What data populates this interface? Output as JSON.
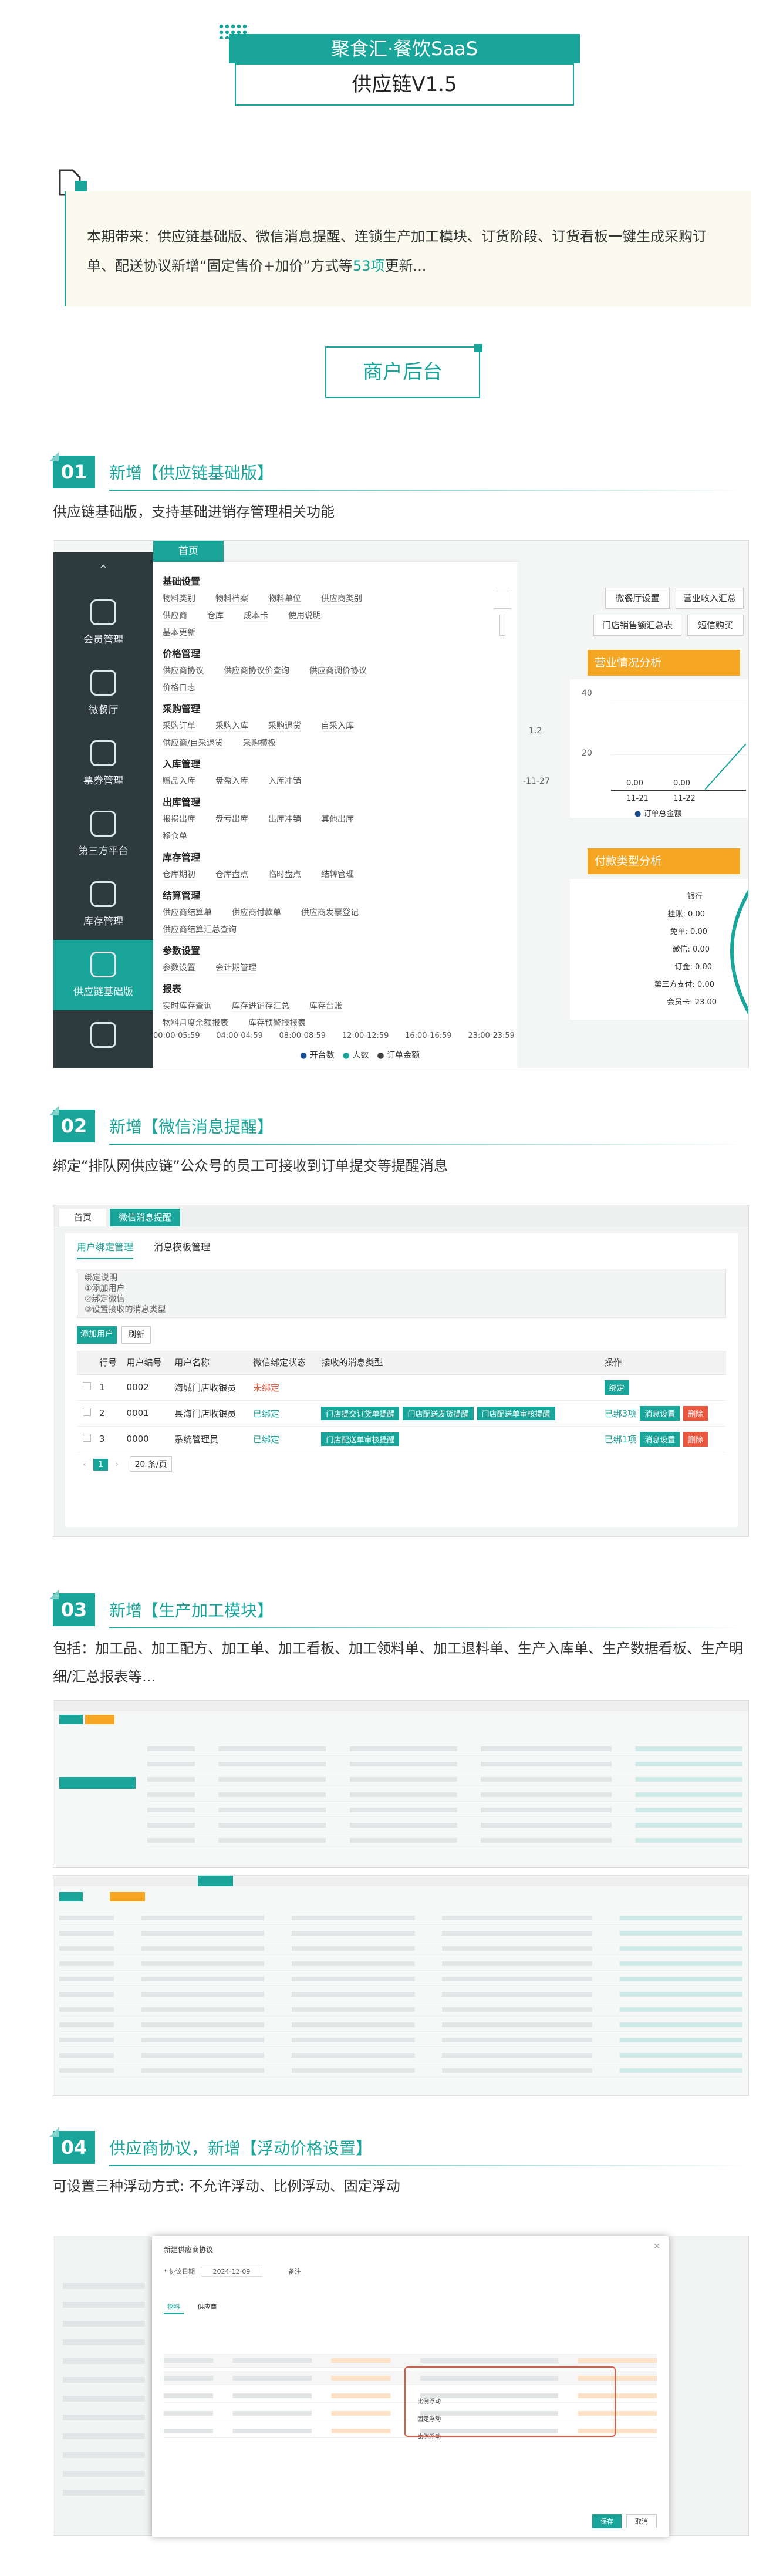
{
  "header": {
    "brand": "聚食汇·餐饮SaaS",
    "version": "供应链V1.5"
  },
  "intro": {
    "text_before": "本期带来：供应链基础版、微信消息提醒、连锁生产加工模块、订货阶段、订货看板一键生成采购订单、配送协议新增“固定售价+加价”方式等",
    "highlight": "53项",
    "text_after": "更新..."
  },
  "merchant_title": "商户后台",
  "sections": [
    {
      "num": "01",
      "title": "新增【供应链基础版】",
      "desc": "供应链基础版，支持基础进销存管理相关功能"
    },
    {
      "num": "02",
      "title": "新增【微信消息提醒】",
      "desc": "绑定“排队网供应链”公众号的员工可接收到订单提交等提醒消息"
    },
    {
      "num": "03",
      "title": "新增【生产加工模块】",
      "desc": "包括：加工品、加工配方、加工单、加工看板、加工领料单、加工退料单、生产入库单、生产数据看板、生产明细/汇总报表等..."
    },
    {
      "num": "04",
      "title": "供应商协议，新增【浮动价格设置】",
      "desc": "可设置三种浮动方式: 不允许浮动、比例浮动、固定浮动"
    }
  ],
  "shot1": {
    "tab": "首页",
    "sidebar": [
      "会员管理",
      "微餐厅",
      "票券管理",
      "第三方平台",
      "库存管理",
      "供应链基础版",
      ""
    ],
    "menu": [
      {
        "group": "基础设置",
        "rows": [
          [
            "物料类别",
            "物料档案",
            "物料单位",
            "供应商类别"
          ],
          [
            "供应商",
            "仓库",
            "成本卡",
            "使用说明"
          ],
          [
            "基本更新"
          ]
        ]
      },
      {
        "group": "价格管理",
        "rows": [
          [
            "供应商协议",
            "供应商协议价查询",
            "供应商调价协议"
          ],
          [
            "价格日志"
          ]
        ]
      },
      {
        "group": "采购管理",
        "rows": [
          [
            "采购订单",
            "采购入库",
            "采购退货",
            "自采入库"
          ],
          [
            "供应商/自采退货",
            "采购横板"
          ]
        ]
      },
      {
        "group": "入库管理",
        "rows": [
          [
            "赠品入库",
            "盘盈入库",
            "入库冲销"
          ]
        ]
      },
      {
        "group": "出库管理",
        "rows": [
          [
            "报损出库",
            "盘亏出库",
            "出库冲销",
            "其他出库"
          ],
          [
            "移仓单"
          ]
        ]
      },
      {
        "group": "库存管理",
        "rows": [
          [
            "仓库期初",
            "仓库盘点",
            "临时盘点",
            "结转管理"
          ]
        ]
      },
      {
        "group": "结算管理",
        "rows": [
          [
            "供应商结算单",
            "供应商付款单",
            "供应商发票登记"
          ],
          [
            "供应商结算汇总查询"
          ]
        ]
      },
      {
        "group": "参数设置",
        "rows": [
          [
            "参数设置",
            "会计期管理"
          ]
        ]
      },
      {
        "group": "报表",
        "rows": [
          [
            "实时库存查询",
            "库存进销存汇总",
            "库存台账"
          ],
          [
            "物料月度余额报表",
            "库存预警报报表"
          ]
        ]
      }
    ],
    "pills": [
      "微餐厅设置",
      "营业收入汇总",
      "门店销售额汇总表",
      "短信购买"
    ],
    "card1": "营业情况分析",
    "card2": "付款类型分析",
    "chart1": {
      "y": [
        "40",
        "20"
      ],
      "values": [
        "0.00",
        "0.00"
      ],
      "x": [
        "11-21",
        "11-22"
      ],
      "legend": "订单总金额",
      "extra": "1.2",
      "date": "-11-27"
    },
    "chart2": {
      "labels": [
        "银行",
        "挂账: 0.00",
        "免单: 0.00",
        "微信: 0.00",
        "订金: 0.00",
        "第三方支付: 0.00",
        "会员卡: 23.00"
      ]
    },
    "bottom": {
      "x": [
        "00:00-05:59",
        "04:00-04:59",
        "08:00-08:59",
        "12:00-12:59",
        "16:00-16:59",
        "23:00-23:59"
      ],
      "legend": [
        "开台数",
        "人数",
        "订单金额"
      ]
    }
  },
  "shot2": {
    "tabs": [
      "首页",
      "微信消息提醒"
    ],
    "subtabs": [
      "用户绑定管理",
      "消息模板管理"
    ],
    "note": [
      "绑定说明",
      "①添加用户",
      "②绑定微信",
      "③设置接收的消息类型"
    ],
    "buttons": [
      "添加用户",
      "刷新"
    ],
    "columns": [
      "",
      "行号",
      "用户编号",
      "用户名称",
      "微信绑定状态",
      "接收的消息类型",
      "操作"
    ],
    "rows": [
      {
        "no": "1",
        "code": "0002",
        "name": "海城门店收银员",
        "status": "未绑定",
        "types": [],
        "ops": [
          "绑定"
        ]
      },
      {
        "no": "2",
        "code": "0001",
        "name": "县海门店收银员",
        "status": "已绑定",
        "types": [
          "门店提交订货单提醒",
          "门店配送发货提醒",
          "门店配送单审核提醒"
        ],
        "ops": [
          "已绑3项",
          "消息设置",
          "删除"
        ]
      },
      {
        "no": "3",
        "code": "0000",
        "name": "系统管理员",
        "status": "已绑定",
        "types": [
          "门店配送单审核提醒"
        ],
        "ops": [
          "已绑1项",
          "消息设置",
          "删除"
        ]
      }
    ],
    "pager": {
      "page": "1",
      "size": "20 条/页"
    }
  },
  "shot4": {
    "dialog_title": "新建供应商协议",
    "fields": [
      "* 协议日期",
      "2024-12-09",
      "备注"
    ],
    "tabs": [
      "物料",
      "供应商"
    ],
    "float_labels": [
      "比例浮动",
      "固定浮动",
      "比例浮动"
    ],
    "footer": [
      "保存",
      "取消"
    ]
  }
}
